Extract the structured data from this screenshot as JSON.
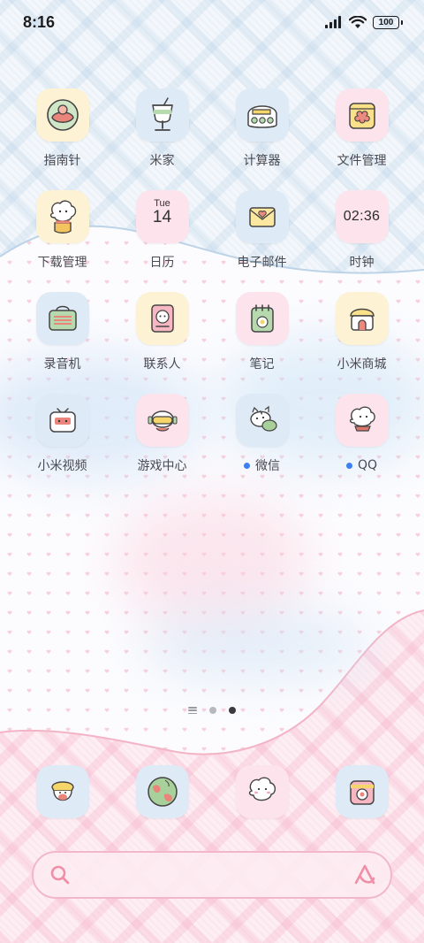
{
  "status_bar": {
    "time": "8:16",
    "battery": "100"
  },
  "apps": [
    {
      "label": "指南针"
    },
    {
      "label": "米家"
    },
    {
      "label": "计算器"
    },
    {
      "label": "文件管理"
    },
    {
      "label": "下载管理"
    },
    {
      "label": "日历",
      "day": "Tue",
      "date": "14"
    },
    {
      "label": "电子邮件"
    },
    {
      "label": "时钟",
      "clock": "02:36"
    },
    {
      "label": "录音机"
    },
    {
      "label": "联系人"
    },
    {
      "label": "笔记"
    },
    {
      "label": "小米商城"
    },
    {
      "label": "小米视频"
    },
    {
      "label": "游戏中心"
    },
    {
      "label": "微信"
    },
    {
      "label": "QQ"
    }
  ],
  "pager": {
    "pages": 2,
    "active_page": 2
  },
  "dock": [
    {
      "icon": "phone-icon"
    },
    {
      "icon": "browser-icon"
    },
    {
      "icon": "messages-icon"
    },
    {
      "icon": "camera-icon"
    }
  ],
  "colors": {
    "notification_dot": "#3b7ff0",
    "search_border": "#f2b8c9"
  }
}
